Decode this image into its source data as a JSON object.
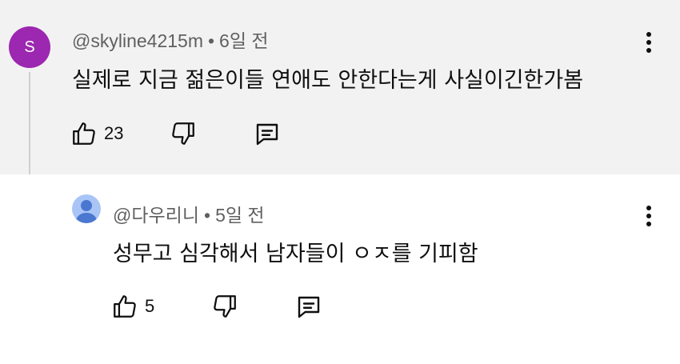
{
  "comments": [
    {
      "avatar_letter": "S",
      "avatar_color": "#9c27b0",
      "author": "@skyline4215m",
      "separator": "•",
      "time": "6일 전",
      "text": "실제로 지금 젊은이들 연애도 안한다는게 사실이긴한가봄",
      "likes": "23",
      "like_icon": "thumbs-up-icon",
      "dislike_icon": "thumbs-down-icon",
      "reply_icon": "reply-icon"
    },
    {
      "avatar_color": "#a9c5f6",
      "author": "@다우리니",
      "separator": "•",
      "time": "5일 전",
      "text": "성무고 심각해서 남자들이 ㅇㅈ를 기피함",
      "likes": "5",
      "like_icon": "thumbs-up-icon",
      "dislike_icon": "thumbs-down-icon",
      "reply_icon": "reply-icon"
    }
  ],
  "colors": {
    "parent_bg": "#f2f2f2",
    "meta": "#606060",
    "text": "#0f0f0f"
  }
}
